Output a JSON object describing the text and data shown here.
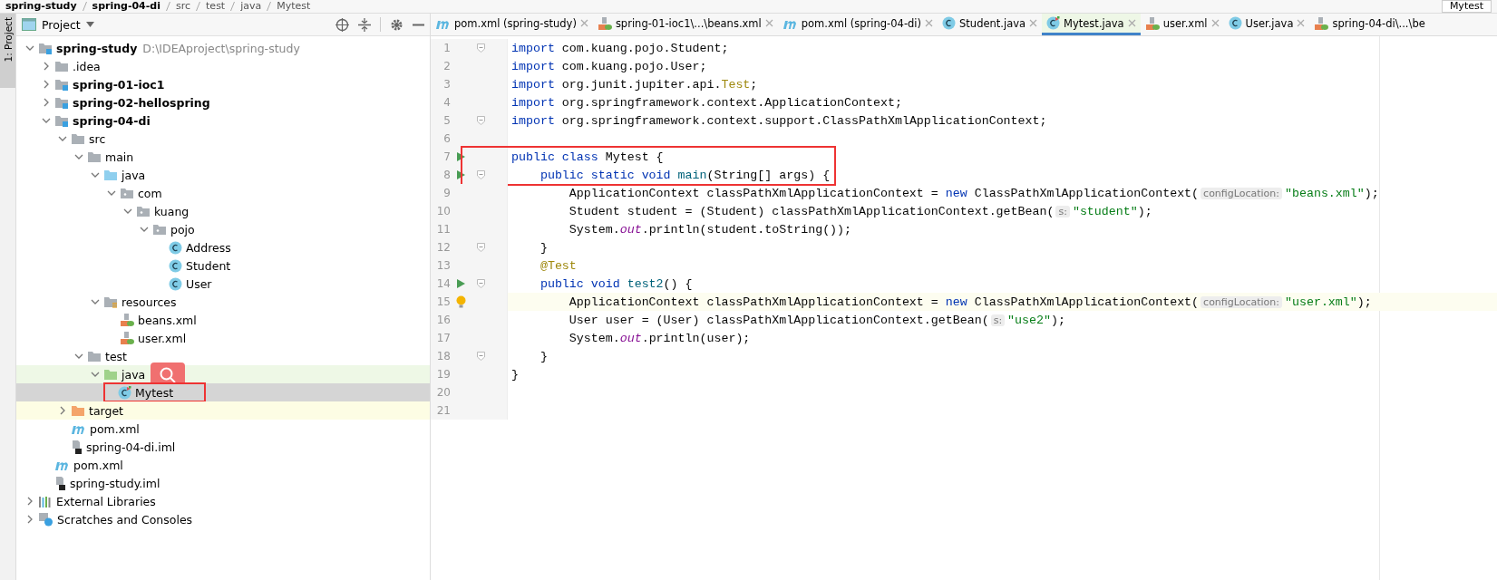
{
  "breadcrumbs": [
    {
      "label": "spring-study",
      "bold": true
    },
    {
      "label": "spring-04-di",
      "bold": true
    },
    {
      "label": "src",
      "bold": false
    },
    {
      "label": "test",
      "bold": false
    },
    {
      "label": "java",
      "bold": false
    },
    {
      "label": "Mytest",
      "bold": false
    }
  ],
  "run_config": "Mytest",
  "side_strip": {
    "label": "1: Project"
  },
  "project_panel": {
    "title": "Project"
  },
  "tree": [
    {
      "label": "spring-study",
      "path": "D:\\IDEAproject\\spring-study",
      "kind": "module",
      "bold": true,
      "expanded": true,
      "selected": false,
      "children": [
        {
          "label": ".idea",
          "kind": "folder",
          "bold": false,
          "expanded": false,
          "selected": false
        },
        {
          "label": "spring-01-ioc1",
          "kind": "module",
          "bold": true,
          "expanded": false,
          "selected": false
        },
        {
          "label": "spring-02-hellospring",
          "kind": "module",
          "bold": true,
          "expanded": false,
          "selected": false
        },
        {
          "label": "spring-04-di",
          "kind": "module",
          "bold": true,
          "expanded": true,
          "selected": false,
          "children": [
            {
              "label": "src",
              "kind": "folder",
              "bold": false,
              "expanded": true,
              "selected": false,
              "children": [
                {
                  "label": "main",
                  "kind": "folder",
                  "bold": false,
                  "expanded": true,
                  "selected": false,
                  "children": [
                    {
                      "label": "java",
                      "kind": "source",
                      "bold": false,
                      "expanded": true,
                      "selected": false,
                      "children": [
                        {
                          "label": "com",
                          "kind": "package",
                          "bold": false,
                          "expanded": true,
                          "selected": false,
                          "children": [
                            {
                              "label": "kuang",
                              "kind": "package",
                              "bold": false,
                              "expanded": true,
                              "selected": false,
                              "children": [
                                {
                                  "label": "pojo",
                                  "kind": "package",
                                  "bold": false,
                                  "expanded": true,
                                  "selected": false,
                                  "children": [
                                    {
                                      "label": "Address",
                                      "kind": "class",
                                      "bold": false,
                                      "selected": false
                                    },
                                    {
                                      "label": "Student",
                                      "kind": "class",
                                      "bold": false,
                                      "selected": false
                                    },
                                    {
                                      "label": "User",
                                      "kind": "class",
                                      "bold": false,
                                      "selected": false
                                    }
                                  ]
                                }
                              ]
                            }
                          ]
                        }
                      ]
                    },
                    {
                      "label": "resources",
                      "kind": "resources",
                      "bold": false,
                      "expanded": true,
                      "selected": false,
                      "children": [
                        {
                          "label": "beans.xml",
                          "kind": "xml",
                          "bold": false,
                          "selected": false
                        },
                        {
                          "label": "user.xml",
                          "kind": "xml",
                          "bold": false,
                          "selected": false
                        }
                      ]
                    }
                  ]
                },
                {
                  "label": "test",
                  "kind": "folder",
                  "bold": false,
                  "expanded": true,
                  "selected": false,
                  "children": [
                    {
                      "label": "java",
                      "kind": "test-source",
                      "bold": false,
                      "expanded": true,
                      "selected": false,
                      "search_badge": true,
                      "children": [
                        {
                          "label": "Mytest",
                          "kind": "test-class",
                          "bold": false,
                          "selected": true,
                          "boxed": true
                        }
                      ]
                    }
                  ]
                }
              ]
            },
            {
              "label": "target",
              "kind": "excluded",
              "bold": false,
              "expanded": false,
              "selected": false
            },
            {
              "label": "pom.xml",
              "kind": "maven",
              "bold": false,
              "selected": false
            },
            {
              "label": "spring-04-di.iml",
              "kind": "iml",
              "bold": false,
              "selected": false
            }
          ]
        },
        {
          "label": "pom.xml",
          "kind": "maven",
          "bold": false,
          "selected": false
        },
        {
          "label": "spring-study.iml",
          "kind": "iml",
          "bold": false,
          "selected": false
        }
      ]
    },
    {
      "label": "External Libraries",
      "kind": "libraries",
      "bold": false,
      "expanded": false,
      "selected": false
    },
    {
      "label": "Scratches and Consoles",
      "kind": "scratches",
      "bold": false,
      "expanded": false,
      "selected": false
    }
  ],
  "tabs": [
    {
      "label": "pom.xml (spring-study)",
      "kind": "maven",
      "selected": false,
      "closable": true
    },
    {
      "label": "spring-01-ioc1\\...\\beans.xml",
      "kind": "xml",
      "selected": false,
      "closable": true
    },
    {
      "label": "pom.xml (spring-04-di)",
      "kind": "maven",
      "selected": false,
      "closable": true
    },
    {
      "label": "Student.java",
      "kind": "class",
      "selected": false,
      "closable": true
    },
    {
      "label": "Mytest.java",
      "kind": "test-class",
      "selected": true,
      "closable": true
    },
    {
      "label": "user.xml",
      "kind": "xml",
      "selected": false,
      "closable": true
    },
    {
      "label": "User.java",
      "kind": "class",
      "selected": false,
      "closable": true
    },
    {
      "label": "spring-04-di\\...\\be",
      "kind": "xml",
      "selected": false,
      "closable": false
    }
  ],
  "code_lines": [
    {
      "number": "1",
      "fold": true,
      "segments": [
        {
          "kind": "kw",
          "text": "import"
        },
        {
          "kind": "plain",
          "text": " com.kuang.pojo.Student;"
        }
      ]
    },
    {
      "number": "2",
      "segments": [
        {
          "kind": "kw",
          "text": "import"
        },
        {
          "kind": "plain",
          "text": " com.kuang.pojo.User;"
        }
      ]
    },
    {
      "number": "3",
      "segments": [
        {
          "kind": "kw",
          "text": "import"
        },
        {
          "kind": "plain",
          "text": " org.junit.jupiter.api."
        },
        {
          "kind": "ann",
          "text": "Test"
        },
        {
          "kind": "plain",
          "text": ";"
        }
      ]
    },
    {
      "number": "4",
      "segments": [
        {
          "kind": "kw",
          "text": "import"
        },
        {
          "kind": "plain",
          "text": " org.springframework.context.ApplicationContext;"
        }
      ]
    },
    {
      "number": "5",
      "fold": true,
      "segments": [
        {
          "kind": "kw",
          "text": "import"
        },
        {
          "kind": "plain",
          "text": " org.springframework.context.support.ClassPathXmlApplicationContext;"
        }
      ]
    },
    {
      "number": "6"
    },
    {
      "number": "7",
      "run": true,
      "boxed": true,
      "segments": [
        {
          "kind": "kw",
          "text": "public class"
        },
        {
          "kind": "plain",
          "text": " Mytest {"
        }
      ]
    },
    {
      "number": "8",
      "run": true,
      "fold": true,
      "boxed": true,
      "segments": [
        {
          "kind": "kw",
          "text": "    public static void"
        },
        {
          "kind": "method",
          "text": " main"
        },
        {
          "kind": "plain",
          "text": "(String[] args) {"
        }
      ]
    },
    {
      "number": "9",
      "segments": [
        {
          "kind": "plain",
          "text": "        ApplicationContext classPathXmlApplicationContext = "
        },
        {
          "kind": "kw",
          "text": "new"
        },
        {
          "kind": "plain",
          "text": " ClassPathXmlApplicationContext("
        },
        {
          "kind": "hint",
          "text": "configLocation:"
        },
        {
          "kind": "str",
          "text": "\"beans.xml\""
        },
        {
          "kind": "plain",
          "text": ");"
        }
      ]
    },
    {
      "number": "10",
      "segments": [
        {
          "kind": "plain",
          "text": "        Student student = (Student) classPathXmlApplicationContext.getBean("
        },
        {
          "kind": "hint",
          "text": "s:"
        },
        {
          "kind": "str",
          "text": "\"student\""
        },
        {
          "kind": "plain",
          "text": ");"
        }
      ]
    },
    {
      "number": "11",
      "segments": [
        {
          "kind": "plain",
          "text": "        System."
        },
        {
          "kind": "field",
          "text": "out"
        },
        {
          "kind": "plain",
          "text": ".println(student.toString());"
        }
      ]
    },
    {
      "number": "12",
      "fold": true,
      "segments": [
        {
          "kind": "plain",
          "text": "    }"
        }
      ]
    },
    {
      "number": "13",
      "segments": [
        {
          "kind": "ann",
          "text": "    @Test"
        }
      ]
    },
    {
      "number": "14",
      "run": true,
      "fold": true,
      "segments": [
        {
          "kind": "kw",
          "text": "    public void"
        },
        {
          "kind": "method",
          "text": " test2"
        },
        {
          "kind": "plain",
          "text": "() {"
        }
      ]
    },
    {
      "number": "15",
      "current": true,
      "bulb": true,
      "segments": [
        {
          "kind": "plain",
          "text": "        ApplicationContext classPathXmlApplicationContext = "
        },
        {
          "kind": "kw",
          "text": "new"
        },
        {
          "kind": "plain",
          "text": " ClassPathXmlApplicationContext("
        },
        {
          "kind": "hint",
          "text": "configLocation:"
        },
        {
          "kind": "str",
          "text": "\"user.xml\""
        },
        {
          "kind": "plain",
          "text": ");"
        }
      ]
    },
    {
      "number": "16",
      "segments": [
        {
          "kind": "plain",
          "text": "        User user = (User) classPathXmlApplicationContext.getBean("
        },
        {
          "kind": "hint",
          "text": "s:"
        },
        {
          "kind": "str",
          "text": "\"use2\""
        },
        {
          "kind": "plain",
          "text": ");"
        }
      ]
    },
    {
      "number": "17",
      "segments": [
        {
          "kind": "plain",
          "text": "        System."
        },
        {
          "kind": "field",
          "text": "out"
        },
        {
          "kind": "plain",
          "text": ".println(user);"
        }
      ]
    },
    {
      "number": "18",
      "fold": true,
      "segments": [
        {
          "kind": "plain",
          "text": "    }"
        }
      ]
    },
    {
      "number": "19",
      "segments": [
        {
          "kind": "plain",
          "text": "}"
        }
      ]
    },
    {
      "number": "20"
    },
    {
      "number": "21"
    }
  ]
}
